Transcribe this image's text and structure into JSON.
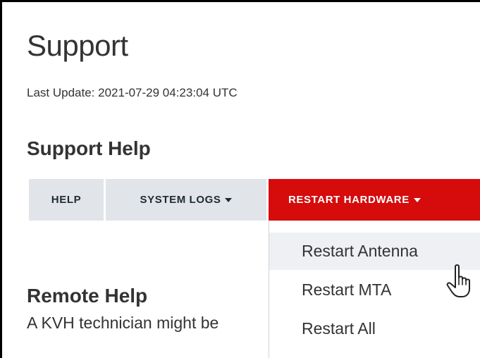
{
  "page": {
    "title": "Support",
    "last_update": "Last Update: 2021-07-29 04:23:04 UTC"
  },
  "support_help": {
    "heading": "Support Help",
    "tabs": [
      {
        "label": "HELP"
      },
      {
        "label": "SYSTEM LOGS"
      },
      {
        "label": "RESTART HARDWARE",
        "active": true
      }
    ],
    "dropdown_items": [
      {
        "label": "Restart Antenna",
        "hovered": true
      },
      {
        "label": "Restart MTA"
      },
      {
        "label": "Restart All"
      }
    ]
  },
  "remote_help": {
    "heading": "Remote Help",
    "text": "A KVH technician might be"
  },
  "colors": {
    "accent": "#d60b0b",
    "tab_bg": "#e1e4e8",
    "text": "#333333",
    "hover_bg": "#eef0f3"
  },
  "icons": {
    "cursor": "hand-pointer-icon"
  }
}
